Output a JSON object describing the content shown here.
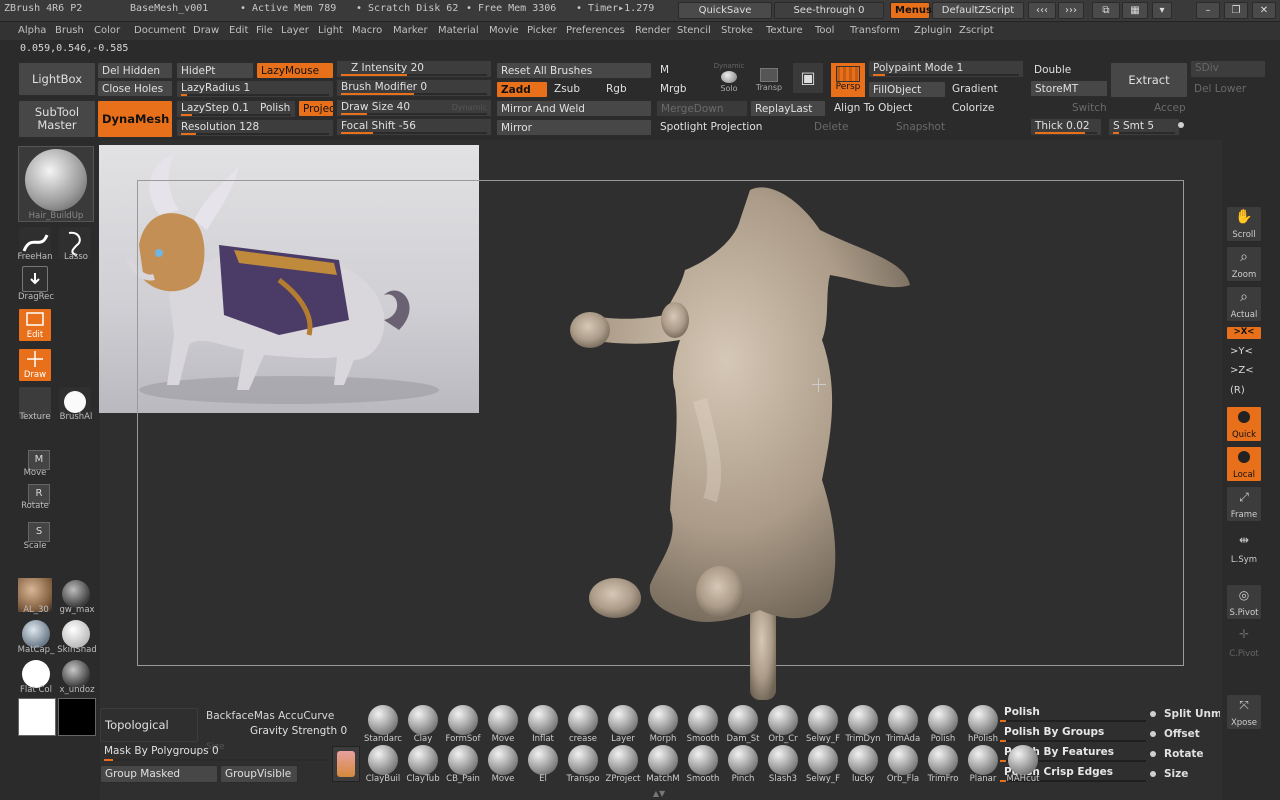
{
  "title_bar": {
    "app": "ZBrush 4R6 P2",
    "file": "BaseMesh_v001",
    "active_mem": "• Active Mem 789",
    "scratch_disk": "• Scratch Disk 62",
    "free_mem": "• Free Mem 3306",
    "timer": "• Timer▸1.279",
    "quicksave": "QuickSave",
    "see_through": "See-through  0",
    "menus": "Menus",
    "default_zscript": "DefaultZScript"
  },
  "menu": [
    "Alpha",
    "Brush",
    "Color",
    "Document",
    "Draw",
    "Edit",
    "File",
    "Layer",
    "Light",
    "Macro",
    "Marker",
    "Material",
    "Movie",
    "Picker",
    "Preferences",
    "Render",
    "Stencil",
    "Stroke",
    "Texture",
    "Tool",
    "Transform",
    "Zplugin",
    "Zscript"
  ],
  "coords": "0.059,0.546,-0.585",
  "toolbar": {
    "lightbox": "LightBox",
    "subtool_master": [
      "SubTool",
      "Master"
    ],
    "dynamesh": "DynaMesh",
    "del_hidden": "Del Hidden",
    "close_holes": "Close Holes",
    "hidept": "HidePt",
    "lazymouse": "LazyMouse",
    "lazyradius": "LazyRadius 1",
    "lazystep": "LazyStep 0.1",
    "polish": "Polish",
    "project": "Projec",
    "resolution": "Resolution 128",
    "z_intensity": "Z Intensity 20",
    "brush_modifier": "Brush Modifier 0",
    "draw_size": "Draw Size 40",
    "dynamic": "Dynamic",
    "focal_shift": "Focal Shift -56",
    "reset_all_brushes": "Reset All Brushes",
    "zadd": "Zadd",
    "zsub": "Zsub",
    "rgb": "Rgb",
    "mirror_and_weld": "Mirror And Weld",
    "mirror": "Mirror",
    "m": "M",
    "mrgb": "Mrgb",
    "dynamic_solo": "Dynamic",
    "solo": "Solo",
    "transp": "Transp",
    "persp": "Persp",
    "mergedown": "MergeDown",
    "replaylast": "ReplayLast",
    "spotlight_projection": "Spotlight Projection",
    "delete": "Delete",
    "snapshot": "Snapshot",
    "polypaint_mode": "Polypaint Mode 1",
    "fillobject": "FillObject",
    "gradient": "Gradient",
    "align_to_object": "Align To Object",
    "colorize": "Colorize",
    "double": "Double",
    "storemt": "StoreMT",
    "extract": "Extract",
    "thick": "Thick 0.02",
    "s_smt": "S Smt 5",
    "switch": "Switch",
    "accept": "Accep",
    "sdiv": "SDiv",
    "del_lower": "Del Lower"
  },
  "left_tray": {
    "brush_name": "Hair_BuildUp",
    "freehand": "FreeHan",
    "lasso": "Lasso",
    "dragrect": "DragRec",
    "edit": "Edit",
    "draw": "Draw",
    "texture": "Texture",
    "brushalpha": "BrushAl",
    "move": "Move",
    "rotate": "Rotate",
    "scale": "Scale",
    "materials": [
      "AL_30",
      "gw_max",
      "MatCap_",
      "SkinShad",
      "Flat Col",
      "x_undoz"
    ]
  },
  "right_tray": [
    "Scroll",
    "Zoom",
    "Actual",
    ">X<",
    ">Y<",
    ">Z<",
    "(R)",
    "Quick",
    "Local",
    "Frame",
    "L.Sym",
    "S.Pivot",
    "C.Pivot",
    "Xpose"
  ],
  "bottom": {
    "topological": "Topological",
    "backface": "BackfaceMas AccuCurve",
    "gravity": "Gravity Strength 0",
    "size": "Size",
    "mask_by_polygroups": "Mask By Polygroups 0",
    "group_masked": "Group Masked",
    "group_visible": "GroupVisible",
    "brushes_row1": [
      "Standarc",
      "Clay",
      "FormSof",
      "Move",
      "Inflat",
      "crease",
      "Layer",
      "Morph",
      "Smooth",
      "Dam_St",
      "Orb_Cr",
      "Selwy_F",
      "TrimDyn",
      "TrimAda",
      "Polish",
      "hPolish"
    ],
    "brushes_row2": [
      "ClayBuil",
      "ClayTub",
      "CB_Pain",
      "Move",
      "El",
      "Transpo",
      "ZProject",
      "MatchM",
      "Smooth",
      "Pinch",
      "Slash3",
      "Selwy_F",
      "lucky",
      "Orb_Fla",
      "TrimFro",
      "Planar",
      "MAHcut"
    ],
    "polish": "Polish",
    "polish_by_groups": "Polish By Groups",
    "polish_by_features": "Polish By Features",
    "polish_crisp_edges": "Polish Crisp Edges",
    "split_unmasked": "Split Unm",
    "offset": "Offset",
    "rotate": "Rotate",
    "size_opt": "Size"
  },
  "colors": {
    "accent": "#e8701a",
    "panel": "#474747",
    "background": "#2b2b2b",
    "model": "#b3a392"
  }
}
